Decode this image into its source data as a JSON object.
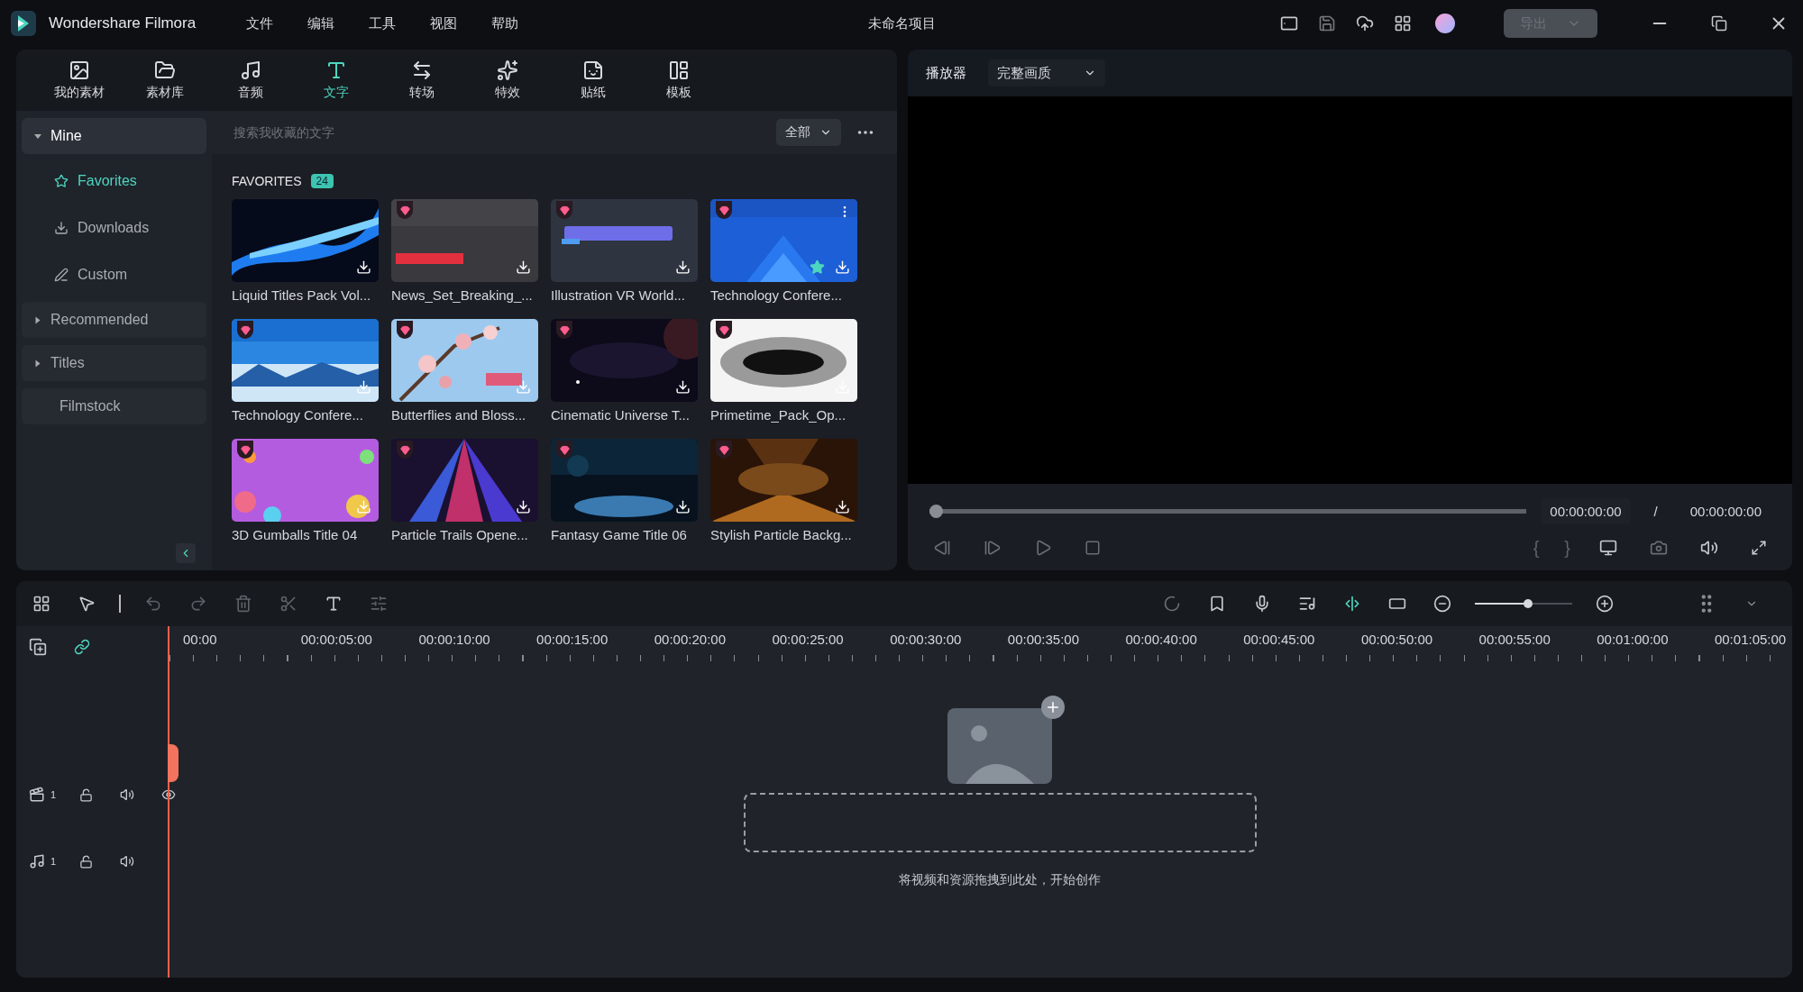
{
  "app": {
    "name": "Wondershare Filmora",
    "menu": [
      "文件",
      "编辑",
      "工具",
      "视图",
      "帮助"
    ],
    "project_title": "未命名项目",
    "export": {
      "label": "导出",
      "disabled": true
    }
  },
  "tabs": [
    {
      "label": "我的素材",
      "selected": false
    },
    {
      "label": "素材库",
      "selected": false
    },
    {
      "label": "音频",
      "selected": false
    },
    {
      "label": "文字",
      "selected": true
    },
    {
      "label": "转场",
      "selected": false
    },
    {
      "label": "特效",
      "selected": false
    },
    {
      "label": "贴纸",
      "selected": false
    },
    {
      "label": "模板",
      "selected": false
    }
  ],
  "sidebar": {
    "items": [
      {
        "label": "Mine",
        "expanded": true,
        "children": [
          {
            "label": "Favorites",
            "selected": true
          },
          {
            "label": "Downloads",
            "selected": false
          },
          {
            "label": "Custom",
            "selected": false
          }
        ]
      },
      {
        "label": "Recommended",
        "expanded": false
      },
      {
        "label": "Titles",
        "expanded": false
      },
      {
        "label": "Filmstock"
      }
    ]
  },
  "search": {
    "placeholder": "搜索我收藏的文字",
    "filter": "全部"
  },
  "favorites": {
    "heading": "FAVORITES",
    "count": "24",
    "items": [
      {
        "title": "Liquid Titles Pack Vol...",
        "premium": false,
        "hovered": false
      },
      {
        "title": "News_Set_Breaking_...",
        "premium": true,
        "hovered": false
      },
      {
        "title": "Illustration VR World...",
        "premium": true,
        "hovered": false
      },
      {
        "title": "Technology Confere...",
        "premium": true,
        "hovered": true
      },
      {
        "title": "Technology Confere...",
        "premium": true,
        "hovered": false
      },
      {
        "title": "Butterflies and Bloss...",
        "premium": true,
        "hovered": false
      },
      {
        "title": "Cinematic Universe T...",
        "premium": true,
        "hovered": false
      },
      {
        "title": "Primetime_Pack_Op...",
        "premium": true,
        "hovered": false
      },
      {
        "title": "3D Gumballs Title 04",
        "premium": true,
        "hovered": false
      },
      {
        "title": "Particle Trails Opene...",
        "premium": true,
        "hovered": false
      },
      {
        "title": "Fantasy Game Title 06",
        "premium": true,
        "hovered": false
      },
      {
        "title": "Stylish Particle Backg...",
        "premium": true,
        "hovered": false
      }
    ]
  },
  "player": {
    "label": "播放器",
    "quality": "完整画质",
    "progress": {
      "level": 0
    },
    "current_time": "00:00:00:00",
    "separator": "/",
    "total_time": "00:00:00:00",
    "marks": [
      "{",
      "}"
    ]
  },
  "timeline": {
    "zoom": {
      "level": 0.55
    },
    "ruler": [
      "00:00",
      "00:00:05:00",
      "00:00:10:00",
      "00:00:15:00",
      "00:00:20:00",
      "00:00:25:00",
      "00:00:30:00",
      "00:00:35:00",
      "00:00:40:00",
      "00:00:45:00",
      "00:00:50:00",
      "00:00:55:00",
      "00:01:00:00",
      "00:01:05:00"
    ],
    "tracks": [
      {
        "kind": "video",
        "number": "1"
      },
      {
        "kind": "audio",
        "number": "1"
      }
    ],
    "drop_hint": "将视频和资源拖拽到此处，开始创作"
  }
}
